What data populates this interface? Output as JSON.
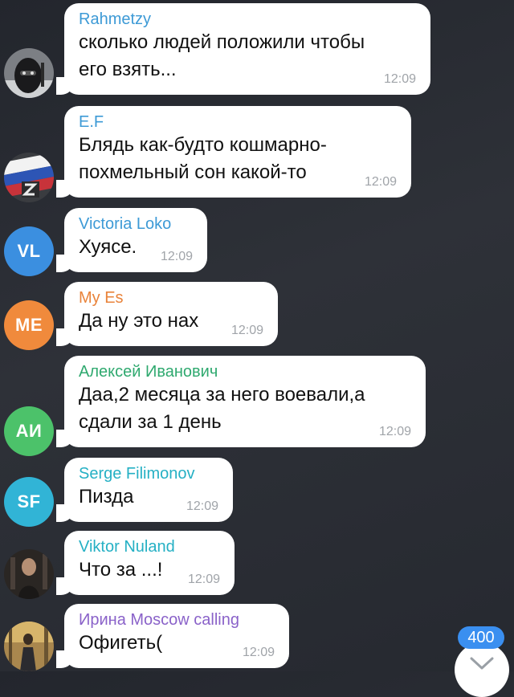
{
  "messages": [
    {
      "sender": "Rahmetzy",
      "sender_color": "#3d9ad6",
      "lines": [
        "сколько людей положили чтобы",
        "его взять..."
      ],
      "time": "12:09",
      "avatar": {
        "type": "photo",
        "description": "balaclava-photo"
      }
    },
    {
      "sender": "E.F",
      "sender_color": "#3d9ad6",
      "lines": [
        "Блядь как-будто кошмарно-",
        "похмельный сон какой-то"
      ],
      "time": "12:09",
      "avatar": {
        "type": "photo",
        "description": "flag-z-photo"
      }
    },
    {
      "sender": "Victoria Loko",
      "sender_color": "#3d9ad6",
      "lines": [
        "Хуясе."
      ],
      "time": "12:09",
      "avatar": {
        "type": "initials",
        "initials": "VL",
        "color": "#3b8fe0"
      }
    },
    {
      "sender": "My Es",
      "sender_color": "#e9833a",
      "lines": [
        "Да ну это нах"
      ],
      "time": "12:09",
      "avatar": {
        "type": "initials",
        "initials": "ME",
        "color": "#f08a3c"
      }
    },
    {
      "sender": "Алексей Иванович",
      "sender_color": "#2fa96f",
      "lines": [
        "Даа,2 месяца за него воевали,а",
        "сдали за 1 день"
      ],
      "time": "12:09",
      "avatar": {
        "type": "initials",
        "initials": "АИ",
        "color": "#4cc26a"
      }
    },
    {
      "sender": "Serge Filimonov",
      "sender_color": "#25b0c4",
      "lines": [
        "Пизда"
      ],
      "time": "12:09",
      "avatar": {
        "type": "initials",
        "initials": "SF",
        "color": "#31b4d6"
      }
    },
    {
      "sender": "Viktor Nuland",
      "sender_color": "#25b0c4",
      "lines": [
        "Что за ...!"
      ],
      "time": "12:09",
      "avatar": {
        "type": "photo",
        "description": "man-dark-photo"
      }
    },
    {
      "sender": "Ирина Moscow calling",
      "sender_color": "#8a62c9",
      "lines": [
        "Офигеть("
      ],
      "time": "12:09",
      "avatar": {
        "type": "photo",
        "description": "outdoor-photo"
      }
    }
  ],
  "unread_badge": "400",
  "icons": {
    "scroll_down": "chevron-down-icon"
  }
}
